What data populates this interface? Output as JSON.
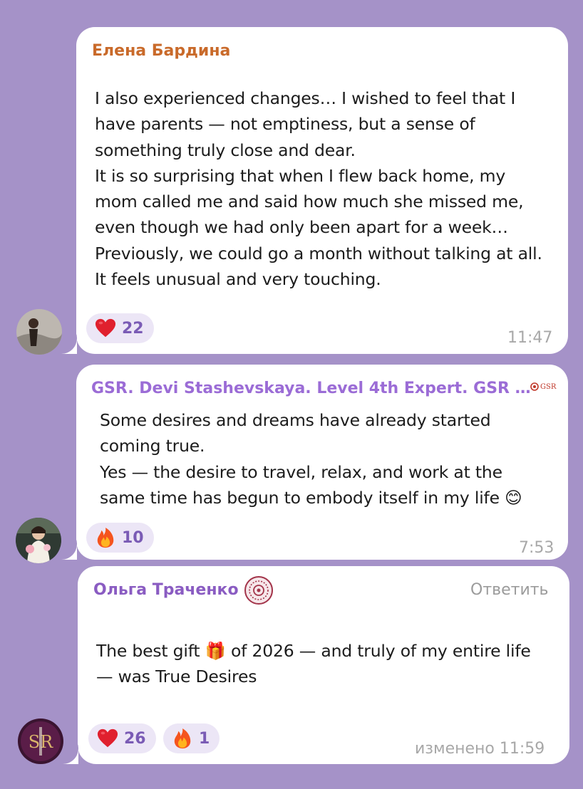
{
  "messages": [
    {
      "author": "Елена Бардина",
      "author_color": "#c96a2a",
      "text": "I also experienced changes… I wished to feel that I\nhave parents — not emptiness, but a sense of\nsomething truly close and dear.\nIt is so surprising that when I flew back home, my\nmom called me and said how much she missed me,\neven though we had only been apart for a week…\nPreviously, we could go a month without talking at all.\nIt feels unusual and very touching.",
      "reactions": [
        {
          "emoji": "heart-icon",
          "count": "22"
        }
      ],
      "time": "11:47"
    },
    {
      "author": "GSR. Devi Stashevskaya. Level 4th Expert. GSR …",
      "author_color": "#9b6cd6",
      "badge": "GSR",
      "text": "Some desires and dreams have already started\ncoming true.\nYes — the desire to travel, relax, and work at the\nsame time has begun to embody itself in my life 😊",
      "reactions": [
        {
          "emoji": "fire-icon",
          "count": "10"
        }
      ],
      "time": "7:53"
    },
    {
      "author": "Ольга Траченко",
      "author_color": "#8a5cc2",
      "reply_label": "Ответить",
      "text": "The best gift 🎁 of 2026 — and truly of my entire life\n— was True Desires",
      "reactions": [
        {
          "emoji": "heart-icon",
          "count": "26"
        },
        {
          "emoji": "fire-icon",
          "count": "1"
        }
      ],
      "time": "изменено 11:59"
    }
  ],
  "colors": {
    "background": "#a592c8",
    "bubble": "#ffffff",
    "reaction_bg": "#ece6f6",
    "reaction_count": "#7a5bb5",
    "time": "#a8a8a8"
  }
}
